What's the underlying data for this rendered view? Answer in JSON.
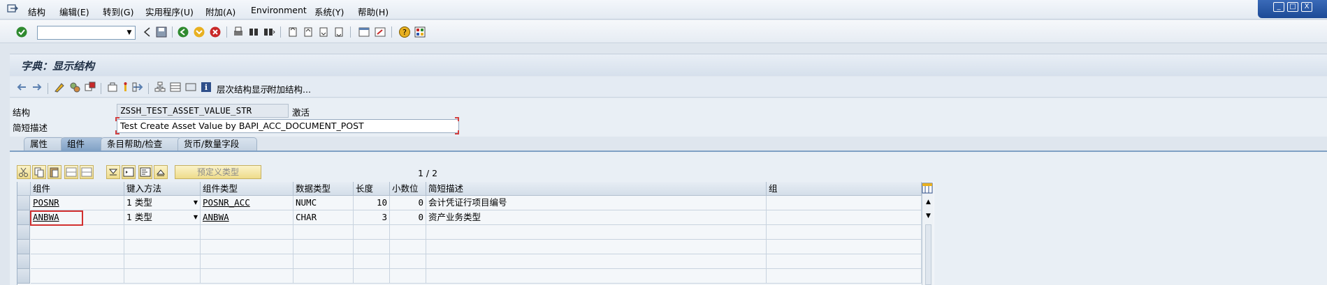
{
  "menu": {
    "items": [
      "结构",
      "编辑(E)",
      "转到(G)",
      "实用程序(U)",
      "附加(A)",
      "Environment",
      "系统(Y)",
      "帮助(H)"
    ]
  },
  "window_controls": [
    "_",
    "□",
    "X"
  ],
  "command_field": {
    "value": ""
  },
  "title": "字典：显示结构",
  "app_toolbar": {
    "hierarchy_label": "层次结构显示",
    "append_label": "附加结构..."
  },
  "form": {
    "structure_label": "结构",
    "structure_value": "ZSSH_TEST_ASSET_VALUE_STR",
    "status": "激活",
    "desc_label": "简短描述",
    "desc_value": "Test Create Asset Value by BAPI_ACC_DOCUMENT_POST"
  },
  "tabs": [
    "属性",
    "组件",
    "条目帮助/检查",
    "货币/数量字段"
  ],
  "active_tab": "组件",
  "table_toolbar": {
    "predefined_type": "预定义类型",
    "pager": "1 / 2"
  },
  "table": {
    "columns": [
      "组件",
      "键入方法",
      "组件类型",
      "数据类型",
      "长度",
      "小数位",
      "简短描述",
      "组"
    ],
    "rows": [
      {
        "component": "POSNR",
        "typing": "1 类型",
        "comp_type": "POSNR_ACC",
        "data_type": "NUMC",
        "length": "10",
        "decimals": "0",
        "desc": "会计凭证行项目编号",
        "group": ""
      },
      {
        "component": "ANBWA",
        "typing": "1 类型",
        "comp_type": "ANBWA",
        "data_type": "CHAR",
        "length": "3",
        "decimals": "0",
        "desc": "资产业务类型",
        "group": ""
      }
    ]
  },
  "colors": {
    "accent": "#7fa0c4",
    "highlight": "#d23030",
    "window_frame": "#1c4a96"
  }
}
